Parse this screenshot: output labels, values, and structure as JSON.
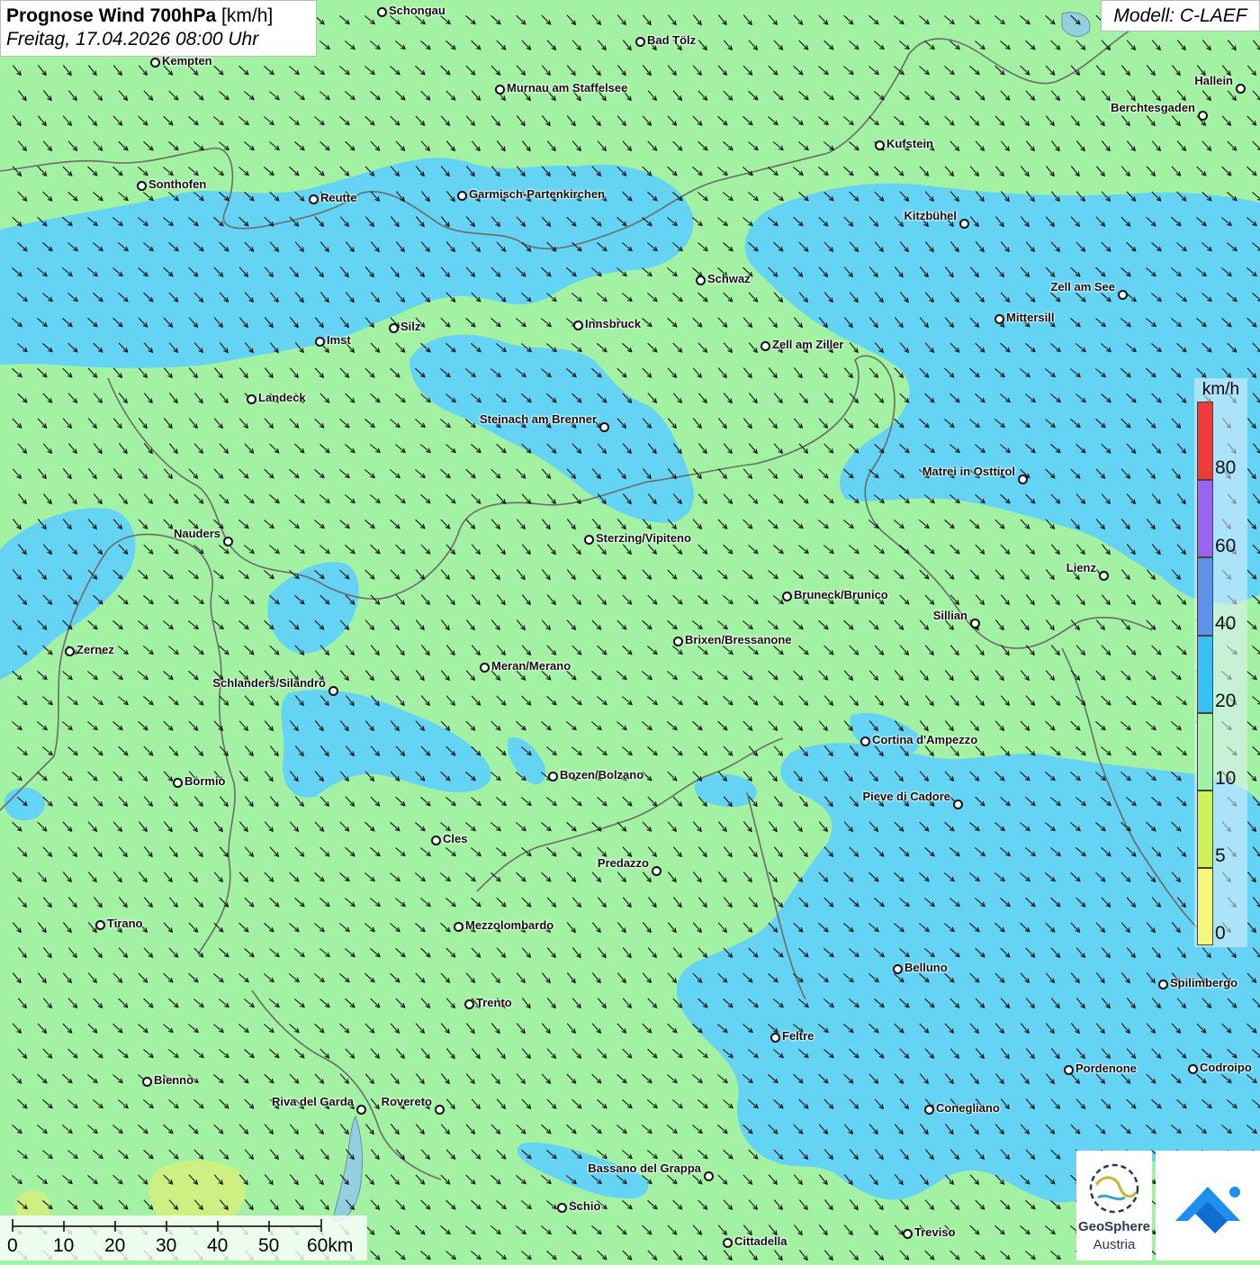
{
  "header": {
    "title_bold": "Prognose Wind 700hPa",
    "title_unit": "[km/h]",
    "subtitle": "Freitag, 17.04.2026 08:00 Uhr",
    "model": "Modell: C-LAEF"
  },
  "legend": {
    "unit": "km/h",
    "labels": [
      "80",
      "60",
      "40",
      "20",
      "10",
      "5",
      "0"
    ],
    "colors": [
      "#f03a3a",
      "#9b63ee",
      "#5e91ea",
      "#36c1f2",
      "#a3f2a3",
      "#cdf25a",
      "#f7f77a"
    ]
  },
  "scalebar": {
    "labels": [
      "0",
      "10",
      "20",
      "30",
      "40",
      "50",
      "60km"
    ]
  },
  "logo": {
    "line1": "GeoSphere",
    "line2": "Austria"
  },
  "colors": {
    "calm": "#a3f2a3",
    "moderate": "#64d3f4",
    "border": "#6b6b6b"
  },
  "cities": [
    {
      "name": "Schongau"
    },
    {
      "name": "Bad Tölz"
    },
    {
      "name": "Kempten"
    },
    {
      "name": "Murnau am Staffelsee"
    },
    {
      "name": "Hallein"
    },
    {
      "name": "Berchtesgaden"
    },
    {
      "name": "Kufstein"
    },
    {
      "name": "Sonthofen"
    },
    {
      "name": "Reutte"
    },
    {
      "name": "Garmisch-Partenkirchen"
    },
    {
      "name": "Kitzbühel"
    },
    {
      "name": "Schwaz"
    },
    {
      "name": "Zell am See"
    },
    {
      "name": "Mittersill"
    },
    {
      "name": "Innsbruck"
    },
    {
      "name": "Silz"
    },
    {
      "name": "Imst"
    },
    {
      "name": "Zell am Ziller"
    },
    {
      "name": "Landeck"
    },
    {
      "name": "Steinach am Brenner"
    },
    {
      "name": "Matrei in Osttirol"
    },
    {
      "name": "Nauders"
    },
    {
      "name": "Sterzing/Vipiteno"
    },
    {
      "name": "Lienz"
    },
    {
      "name": "Bruneck/Brunico"
    },
    {
      "name": "Sillian"
    },
    {
      "name": "Zernez"
    },
    {
      "name": "Brixen/Bressanone"
    },
    {
      "name": "Meran/Merano"
    },
    {
      "name": "Schlanders/Silandro"
    },
    {
      "name": "Cortina d'Ampezzo"
    },
    {
      "name": "Bozen/Bolzano"
    },
    {
      "name": "Bormio"
    },
    {
      "name": "Pieve di Cadore"
    },
    {
      "name": "Cles"
    },
    {
      "name": "Predazzo"
    },
    {
      "name": "Tirano"
    },
    {
      "name": "Mezzolombardo"
    },
    {
      "name": "Belluno"
    },
    {
      "name": "Spilimbergo"
    },
    {
      "name": "Trento"
    },
    {
      "name": "Feltre"
    },
    {
      "name": "Bienno"
    },
    {
      "name": "Pordenone"
    },
    {
      "name": "Codroipo"
    },
    {
      "name": "Riva del Garda"
    },
    {
      "name": "Rovereto"
    },
    {
      "name": "Conegliano"
    },
    {
      "name": "Bassano del Grappa"
    },
    {
      "name": "Schio"
    },
    {
      "name": "Treviso"
    },
    {
      "name": "Cittadella"
    }
  ]
}
